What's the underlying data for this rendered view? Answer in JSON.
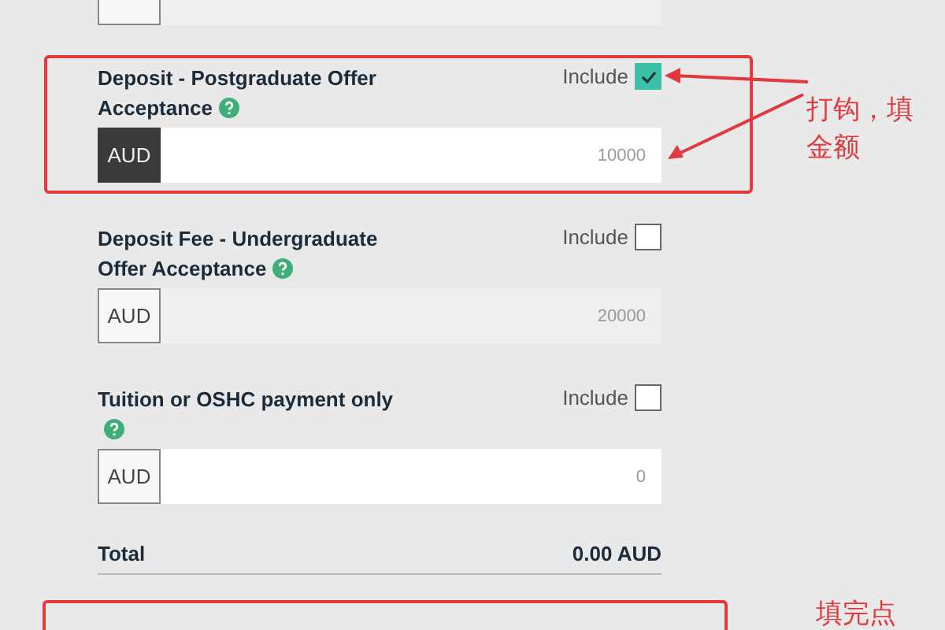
{
  "items": [
    {
      "title": "Deposit - Postgraduate Offer Acceptance",
      "include_label": "Include",
      "checked": true,
      "currency": "AUD",
      "currency_active": true,
      "value": "10000",
      "disabled": false,
      "highlighted": true
    },
    {
      "title": "Deposit Fee - Undergraduate Offer Acceptance",
      "include_label": "Include",
      "checked": false,
      "currency": "AUD",
      "currency_active": false,
      "value": "20000",
      "disabled": true,
      "highlighted": false
    },
    {
      "title": "Tuition or OSHC payment only",
      "include_label": "Include",
      "checked": false,
      "currency": "AUD",
      "currency_active": false,
      "value": "0",
      "disabled": false,
      "highlighted": false
    }
  ],
  "total": {
    "label": "Total",
    "amount": "0.00 AUD"
  },
  "annotations": [
    {
      "text": "打钩，填金额"
    },
    {
      "text": "填完点"
    }
  ]
}
